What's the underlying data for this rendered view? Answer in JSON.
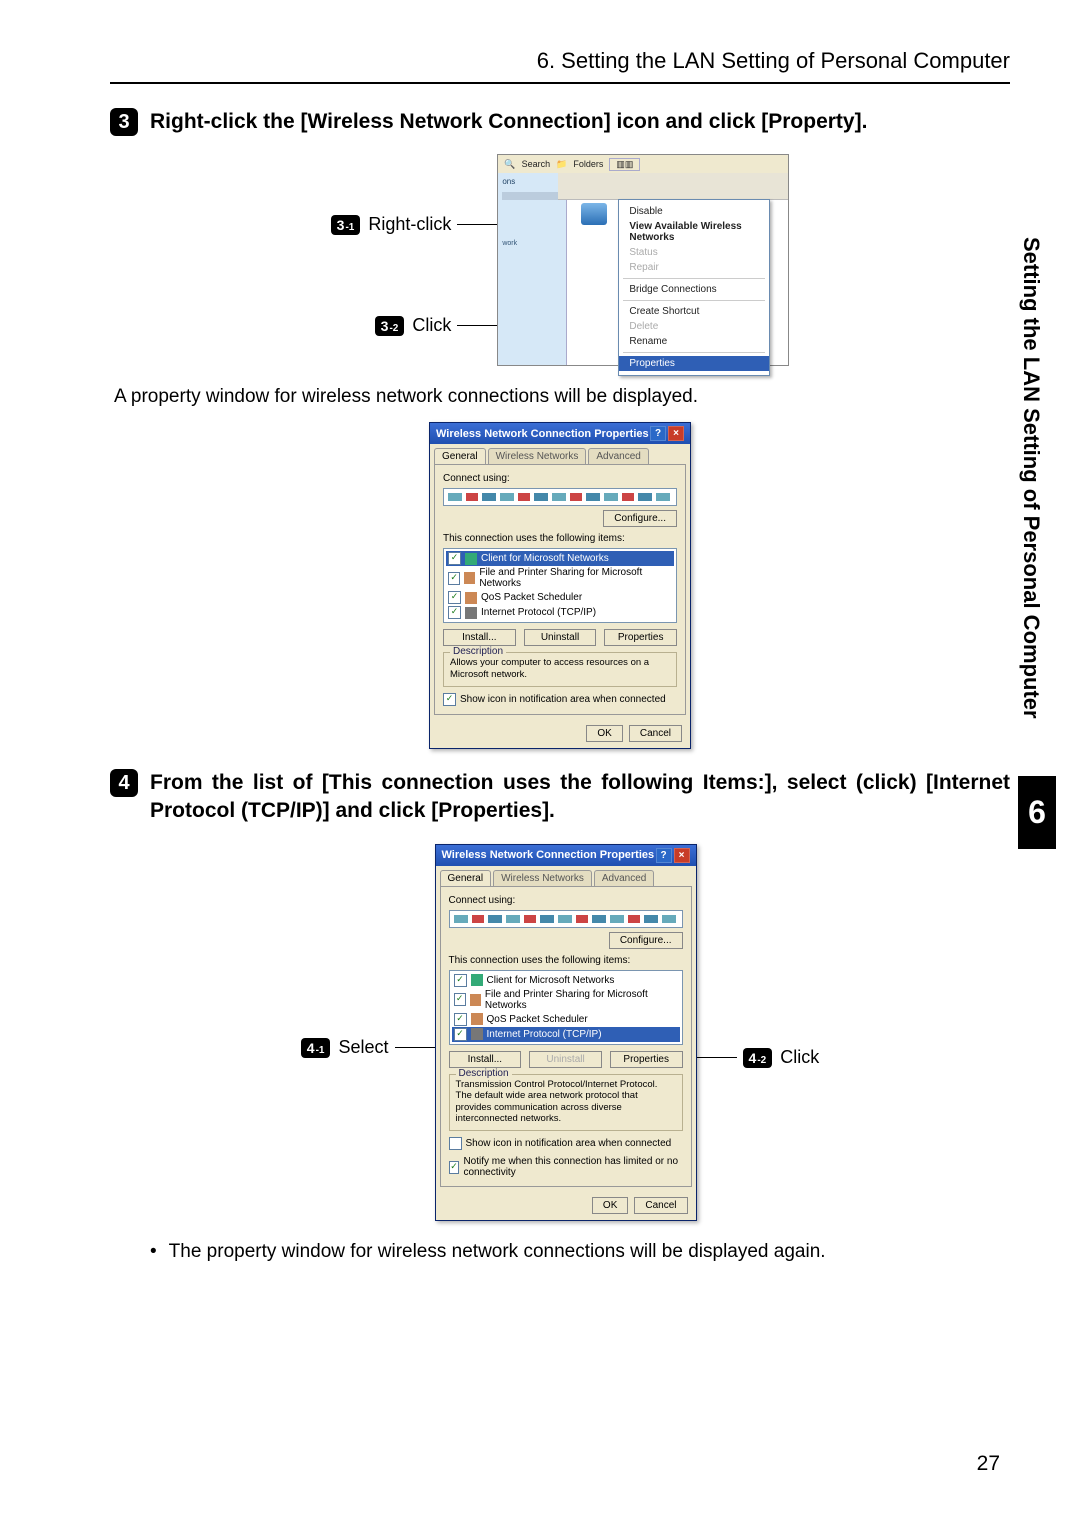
{
  "header": {
    "title": "6. Setting the LAN Setting of Personal Computer"
  },
  "side": {
    "label": "Setting the LAN Setting of Personal Computer",
    "chapter": "6"
  },
  "step3": {
    "num": "3",
    "text": "Right-click the [Wireless Network Connection] icon and click [Property].",
    "sub1": {
      "badge_main": "3",
      "badge_sub": "-1",
      "label": "Right-click"
    },
    "sub2": {
      "badge_main": "3",
      "badge_sub": "-2",
      "label": "Click"
    }
  },
  "shot1": {
    "toolbar": {
      "search": "Search",
      "folders": "Folders"
    },
    "pane": {
      "line1": "ons"
    },
    "menu": {
      "disable": "Disable",
      "view": "View Available Wireless Networks",
      "status": "Status",
      "repair": "Repair",
      "bridge": "Bridge Connections",
      "shortcut": "Create Shortcut",
      "delete": "Delete",
      "rename": "Rename",
      "properties": "Properties"
    }
  },
  "note_after_3": "A property window for wireless network connections will be displayed.",
  "dlg1": {
    "title": "Wireless Network Connection Properties",
    "tabs": {
      "general": "General",
      "wireless": "Wireless Networks",
      "advanced": "Advanced"
    },
    "connect_using": "Connect using:",
    "configure": "Configure...",
    "items_label": "This connection uses the following items:",
    "items": {
      "client": "Client for Microsoft Networks",
      "fileprint": "File and Printer Sharing for Microsoft Networks",
      "qos": "QoS Packet Scheduler",
      "tcpip": "Internet Protocol (TCP/IP)"
    },
    "install": "Install...",
    "uninstall": "Uninstall",
    "properties": "Properties",
    "desc_label": "Description",
    "desc_text": "Allows your computer to access resources on a Microsoft network.",
    "showicon": "Show icon in notification area when connected",
    "ok": "OK",
    "cancel": "Cancel"
  },
  "step4": {
    "num": "4",
    "text": "From the list of [This connection uses the following Items:], select (click) [Internet Protocol (TCP/IP)] and click [Properties].",
    "sub1": {
      "badge_main": "4",
      "badge_sub": "-1",
      "label": "Select"
    },
    "sub2": {
      "badge_main": "4",
      "badge_sub": "-2",
      "label": "Click"
    }
  },
  "dlg2": {
    "title": "Wireless Network Connection Properties",
    "tabs": {
      "general": "General",
      "wireless": "Wireless Networks",
      "advanced": "Advanced"
    },
    "connect_using": "Connect using:",
    "configure": "Configure...",
    "items_label": "This connection uses the following items:",
    "items": {
      "client": "Client for Microsoft Networks",
      "fileprint": "File and Printer Sharing for Microsoft Networks",
      "qos": "QoS Packet Scheduler",
      "tcpip": "Internet Protocol (TCP/IP)"
    },
    "install": "Install...",
    "uninstall": "Uninstall",
    "properties": "Properties",
    "desc_label": "Description",
    "desc_text": "Transmission Control Protocol/Internet Protocol. The default wide area network protocol that provides communication across diverse interconnected networks.",
    "showicon": "Show icon in notification area when connected",
    "notify": "Notify me when this connection has limited or no connectivity",
    "ok": "OK",
    "cancel": "Cancel"
  },
  "bullet_after_4": "The property window for wireless network connections will be displayed again.",
  "pagenum": "27"
}
